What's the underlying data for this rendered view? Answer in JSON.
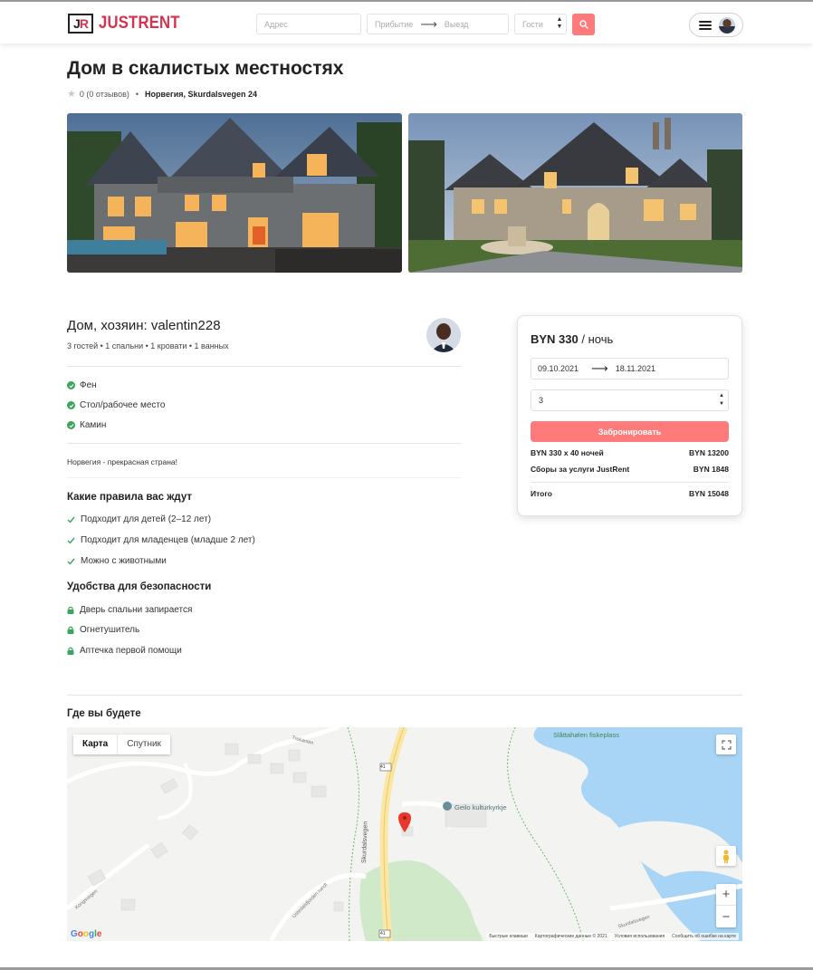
{
  "brand": {
    "mark": "JR",
    "name": "JUSTRENT",
    "color": "#d7334f"
  },
  "search": {
    "address_placeholder": "Адрес",
    "checkin_placeholder": "Прибытие",
    "checkout_placeholder": "Выезд",
    "guests_placeholder": "Гости",
    "button_icon": "search-icon",
    "button_color": "#ff7a7a"
  },
  "user_menu": {
    "menu_icon": "hamburger-icon",
    "avatar": "user-avatar"
  },
  "listing": {
    "title": "Дом в скалистых местностях",
    "rating": "0 (0 отзывов)",
    "location": "Норвегия, Skurdalsvegen 24",
    "host_title": "Дом, хозяин: valentin228",
    "host_meta": "3 гостей • 1 спальни • 1 кровати • 1 ванных",
    "amenities": [
      "Фен",
      "Стол/рабочее место",
      "Камин"
    ],
    "description": "Норвегия - прекрасная страна!",
    "rules_title": "Какие правила вас ждут",
    "rules": [
      "Подходит для детей (2–12 лет)",
      "Подходит для младенцев (младше 2 лет)",
      "Можно с животными"
    ],
    "safety_title": "Удобства для безопасности",
    "safety": [
      "Дверь спальни запирается",
      "Огнетушитель",
      "Аптечка первой помощи"
    ]
  },
  "booking": {
    "price": "BYN 330",
    "per": "/ ночь",
    "checkin": "09.10.2021",
    "checkout": "18.11.2021",
    "guests": "3",
    "button": "Забронировать",
    "nights_label": "BYN 330 x 40 ночей",
    "nights_value": "BYN 13200",
    "fee_label": "Сборы за услуги JustRent",
    "fee_value": "BYN 1848",
    "total_label": "Итого",
    "total_value": "BYN 15048"
  },
  "map": {
    "section_title": "Где вы будете",
    "tab_map": "Карта",
    "tab_satellite": "Спутник",
    "labels": {
      "church": "Geilo kulturkyrkje",
      "fishing": "Slåttahølen fiskeplass",
      "road_main": "Skurdalsvegen",
      "road_41": "41",
      "road_41b": "41",
      "trekanten": "Trekanten",
      "utsiktsvegen": "Ustedalsfjorden rundt",
      "skurdalsvegen2": "Skurdalsvegen",
      "kongsvegen": "Kongsvegen"
    },
    "google": "Google",
    "footer": [
      "Быстрые клавиши",
      "Картографические данные © 2021",
      "Условия использования",
      "Сообщить об ошибке на карте"
    ],
    "water_color": "#a8d4f5",
    "park_color": "#cfe9c9",
    "road_color": "#fbe7a3"
  }
}
